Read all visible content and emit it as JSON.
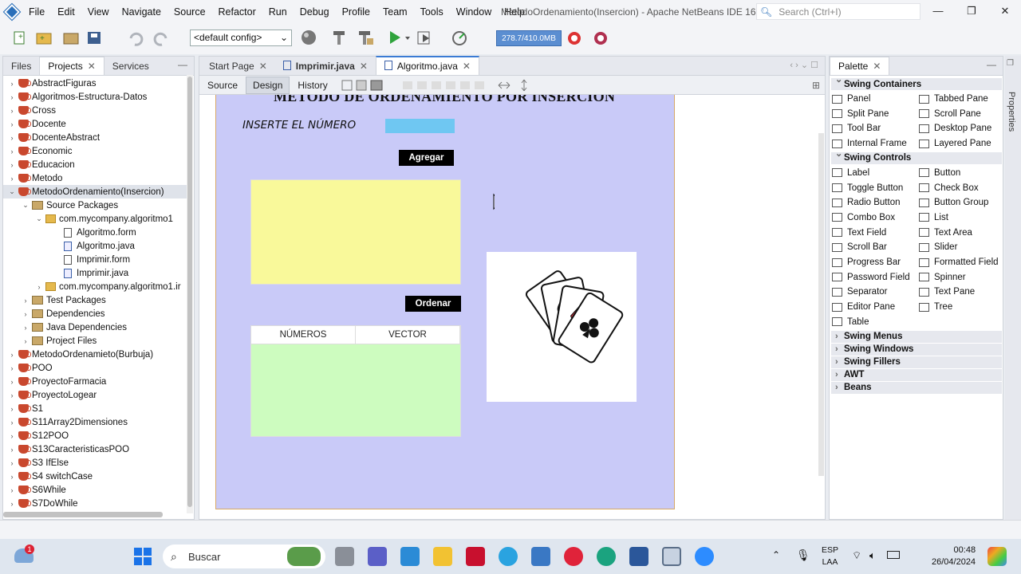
{
  "menu": [
    "File",
    "Edit",
    "View",
    "Navigate",
    "Source",
    "Refactor",
    "Run",
    "Debug",
    "Profile",
    "Team",
    "Tools",
    "Window",
    "Help"
  ],
  "window_title": "MetodoOrdenamiento(Insercion) - Apache NetBeans IDE 16",
  "search_placeholder": "Search (Ctrl+I)",
  "config_select": "<default config>",
  "memory": "278.7/410.0MB",
  "left_tabs": {
    "files": "Files",
    "projects": "Projects",
    "services": "Services"
  },
  "tree": [
    {
      "label": "AbstractFiguras",
      "type": "project",
      "level": 0
    },
    {
      "label": "Algoritmos-Estructura-Datos",
      "type": "project",
      "level": 0
    },
    {
      "label": "Cross",
      "type": "project",
      "level": 0
    },
    {
      "label": "Docente",
      "type": "project",
      "level": 0
    },
    {
      "label": "DocenteAbstract",
      "type": "project",
      "level": 0
    },
    {
      "label": "Economic",
      "type": "project",
      "level": 0
    },
    {
      "label": "Educacion",
      "type": "project",
      "level": 0
    },
    {
      "label": "Metodo",
      "type": "project",
      "level": 0
    },
    {
      "label": "MetodoOrdenamiento(Insercion)",
      "type": "project",
      "level": 0,
      "expanded": true,
      "selected": true
    },
    {
      "label": "Source Packages",
      "type": "folder",
      "level": 1,
      "expanded": true
    },
    {
      "label": "com.mycompany.algoritmo1",
      "type": "package",
      "level": 2,
      "expanded": true
    },
    {
      "label": "Algoritmo.form",
      "type": "file",
      "level": 3
    },
    {
      "label": "Algoritmo.java",
      "type": "java",
      "level": 3
    },
    {
      "label": "Imprimir.form",
      "type": "file",
      "level": 3
    },
    {
      "label": "Imprimir.java",
      "type": "java",
      "level": 3
    },
    {
      "label": "com.mycompany.algoritmo1.ir",
      "type": "package",
      "level": 2
    },
    {
      "label": "Test Packages",
      "type": "folder",
      "level": 1
    },
    {
      "label": "Dependencies",
      "type": "folder",
      "level": 1
    },
    {
      "label": "Java Dependencies",
      "type": "folder",
      "level": 1
    },
    {
      "label": "Project Files",
      "type": "folder",
      "level": 1
    },
    {
      "label": "MetodoOrdenamieto(Burbuja)",
      "type": "project",
      "level": 0
    },
    {
      "label": "POO",
      "type": "project",
      "level": 0
    },
    {
      "label": "ProyectoFarmacia",
      "type": "project",
      "level": 0
    },
    {
      "label": "ProyectoLogear",
      "type": "project",
      "level": 0
    },
    {
      "label": "S1",
      "type": "project",
      "level": 0
    },
    {
      "label": "S11Array2Dimensiones",
      "type": "project",
      "level": 0
    },
    {
      "label": "S12POO",
      "type": "project",
      "level": 0
    },
    {
      "label": "S13CaracteristicasPOO",
      "type": "project",
      "level": 0
    },
    {
      "label": "S3 IfElse",
      "type": "project",
      "level": 0
    },
    {
      "label": "S4 switchCase",
      "type": "project",
      "level": 0
    },
    {
      "label": "S6While",
      "type": "project",
      "level": 0
    },
    {
      "label": "S7DoWhile",
      "type": "project",
      "level": 0
    }
  ],
  "editor_tabs": [
    {
      "label": "Start Page"
    },
    {
      "label": "Imprimir.java"
    },
    {
      "label": "Algoritmo.java",
      "active": true
    }
  ],
  "editor_modes": {
    "source": "Source",
    "design": "Design",
    "history": "History"
  },
  "form": {
    "title": "METODO DE ORDENAMIENTO POR INSERCION",
    "label": "INSERTE EL NÚMERO",
    "add_button": "Agregar",
    "sort_button": "Ordenar",
    "table_headers": [
      "NÚMEROS",
      "VECTOR"
    ],
    "colors": {
      "background": "#c9caf8",
      "input": "#6fc7f2",
      "textarea": "#f9f99a",
      "table": "#cdfcbf"
    }
  },
  "palette": {
    "title": "Palette",
    "categories": [
      {
        "name": "Swing Containers",
        "items": [
          "Panel",
          "Tabbed Pane",
          "Split Pane",
          "Scroll Pane",
          "Tool Bar",
          "Desktop Pane",
          "Internal Frame",
          "Layered Pane"
        ]
      },
      {
        "name": "Swing Controls",
        "items": [
          "Label",
          "Button",
          "Toggle Button",
          "Check Box",
          "Radio Button",
          "Button Group",
          "Combo Box",
          "List",
          "Text Field",
          "Text Area",
          "Scroll Bar",
          "Slider",
          "Progress Bar",
          "Formatted Field",
          "Password Field",
          "Spinner",
          "Separator",
          "Text Pane",
          "Editor Pane",
          "Tree",
          "Table"
        ]
      },
      {
        "name": "Swing Menus"
      },
      {
        "name": "Swing Windows"
      },
      {
        "name": "Swing Fillers"
      },
      {
        "name": "AWT"
      },
      {
        "name": "Beans"
      }
    ]
  },
  "properties_label": "Properties",
  "taskbar": {
    "search_placeholder": "Buscar",
    "notification_badge": "1",
    "lang_top": "ESP",
    "lang_bottom": "LAA",
    "time": "00:48",
    "date": "26/04/2024"
  }
}
